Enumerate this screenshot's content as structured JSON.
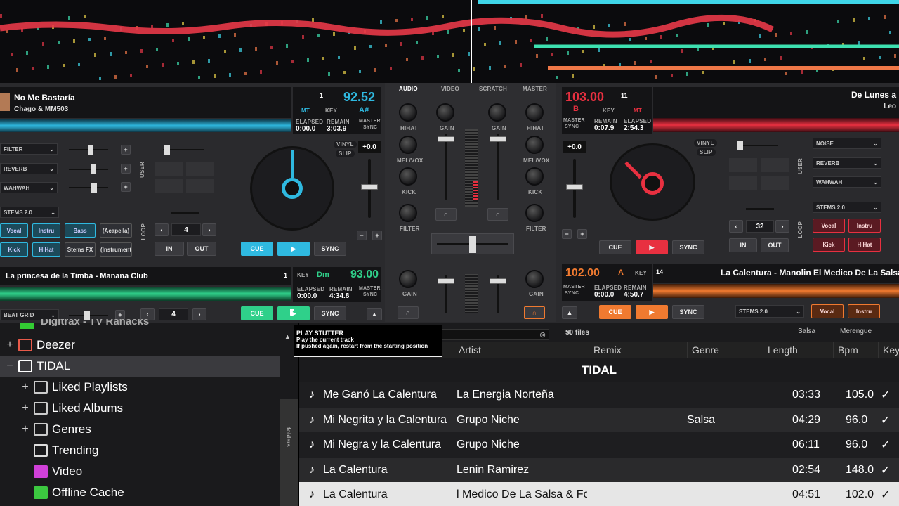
{
  "deck_left_top": {
    "title": "No Me Bastaría",
    "artist": "Chago & MM503",
    "deck_no": "1",
    "bpm": "92.52",
    "mt": "MT",
    "key_label": "KEY",
    "key": "A#",
    "elapsed_label": "ELAPSED",
    "elapsed": "0:00.0",
    "remain_label": "REMAIN",
    "remain": "3:03.9",
    "master_label": "MASTER",
    "sync_label": "SYNC",
    "pitch": "+0.0",
    "vinyl": "VINYL",
    "slip": "SLIP",
    "fx": [
      "FILTER",
      "REVERB",
      "WAHWAH"
    ],
    "user_label": "USER",
    "stems": "STEMS 2.0",
    "loop_label": "LOOP",
    "loop_size": "4",
    "in_label": "IN",
    "out_label": "OUT",
    "pads": [
      "Vocal",
      "Instru",
      "Bass",
      "(Acapella)",
      "Kick",
      "HiHat",
      "Stems FX",
      "(Instrument"
    ],
    "cue": "CUE",
    "sync": "SYNC",
    "accent": "#2fb9e0"
  },
  "deck_left_bottom": {
    "title": "La princesa de la Timba - Manana Club",
    "deck_no": "1",
    "key_label": "KEY",
    "key": "Dm",
    "bpm": "93.00",
    "elapsed_label": "ELAPSED",
    "elapsed": "0:00.0",
    "remain_label": "REMAIN",
    "remain": "4:34.8",
    "master_label": "MASTER",
    "sync_label": "SYNC",
    "beat_grid": "BEAT GRID",
    "loop_size": "4",
    "cue": "CUE",
    "sync": "SYNC",
    "accent": "#2fd08a"
  },
  "deck_right_top": {
    "bpm": "103.00",
    "deck_no": "11",
    "key_label": "KEY",
    "b": "B",
    "mt": "MT",
    "master_label": "MASTER",
    "sync_label": "SYNC",
    "remain_label": "REMAIN",
    "remain": "0:07.9",
    "elapsed_label": "ELAPSED",
    "elapsed": "2:54.3",
    "title": "De Lunes a",
    "artist": "Leo",
    "pitch": "+0.0",
    "vinyl": "VINYL",
    "slip": "SLIP",
    "fx": [
      "NOISE",
      "REVERB",
      "WAHWAH"
    ],
    "user_label": "USER",
    "stems": "STEMS 2.0",
    "loop_label": "LOOP",
    "loop_size": "32",
    "in_label": "IN",
    "out_label": "OUT",
    "pads": [
      "Vocal",
      "Instru",
      "Kick",
      "HiHat"
    ],
    "cue": "CUE",
    "sync": "SYNC",
    "accent": "#e83040"
  },
  "deck_right_bottom": {
    "bpm": "102.00",
    "key_letter": "A",
    "key_label": "KEY",
    "deck_no": "14",
    "title": "La Calentura - Manolin El Medico De La Salsa &",
    "master_label": "MASTER",
    "sync_label": "SYNC",
    "elapsed_label": "ELAPSED",
    "elapsed": "0:00.0",
    "remain_label": "REMAIN",
    "remain": "4:50.7",
    "stems": "STEMS 2.0",
    "pads": [
      "Vocal",
      "Instru"
    ],
    "cue": "CUE",
    "sync": "SYNC",
    "accent": "#f07a30"
  },
  "mixer": {
    "tabs": [
      "AUDIO",
      "VIDEO",
      "SCRATCH",
      "MASTER"
    ],
    "knobs_left": [
      "HIHAT",
      "MEL/VOX",
      "KICK",
      "FILTER"
    ],
    "knobs_right": [
      "HIHAT",
      "MEL/VOX",
      "KICK",
      "FILTER"
    ],
    "gain": "GAIN"
  },
  "tooltip": {
    "title": "PLAY STUTTER",
    "line1": "Play the current track",
    "line2": "If pushed again, restart from the starting position"
  },
  "browser": {
    "tree_partial": "Digitrax - TV Ranacks",
    "tree": [
      {
        "pm": "+",
        "label": "Deezer"
      },
      {
        "pm": "−",
        "label": "TIDAL"
      },
      {
        "pm": "+",
        "label": "Liked Playlists"
      },
      {
        "pm": "+",
        "label": "Liked Albums"
      },
      {
        "pm": "+",
        "label": "Genres"
      },
      {
        "pm": "",
        "label": "Trending"
      },
      {
        "pm": "",
        "label": "Video"
      },
      {
        "pm": "",
        "label": "Offline Cache"
      }
    ],
    "folders_tab": "folders",
    "file_count": "50 files",
    "genre_chips": [
      "Salsa",
      "Merengue"
    ],
    "columns": [
      "Artist",
      "Remix",
      "Genre",
      "Length",
      "Bpm",
      "Key"
    ],
    "group_title": "TIDAL",
    "rows": [
      {
        "title": "Me Ganó La Calentura",
        "artist": "La Energia Norteña",
        "genre": "",
        "length": "03:33",
        "bpm": "105.0"
      },
      {
        "title": "Mi Negrita y la Calentura",
        "artist": "Grupo  Niche",
        "genre": "Salsa",
        "length": "04:29",
        "bpm": "96.0"
      },
      {
        "title": "Mi Negra y la Calentura",
        "artist": "Grupo Niche",
        "genre": "",
        "length": "06:11",
        "bpm": "96.0"
      },
      {
        "title": "La Calentura",
        "artist": "Lenin Ramirez",
        "genre": "",
        "length": "02:54",
        "bpm": "148.0"
      },
      {
        "title": "La Calentura",
        "artist": "l Medico De La Salsa & Formula E",
        "genre": "",
        "length": "04:51",
        "bpm": "102.0"
      }
    ]
  }
}
